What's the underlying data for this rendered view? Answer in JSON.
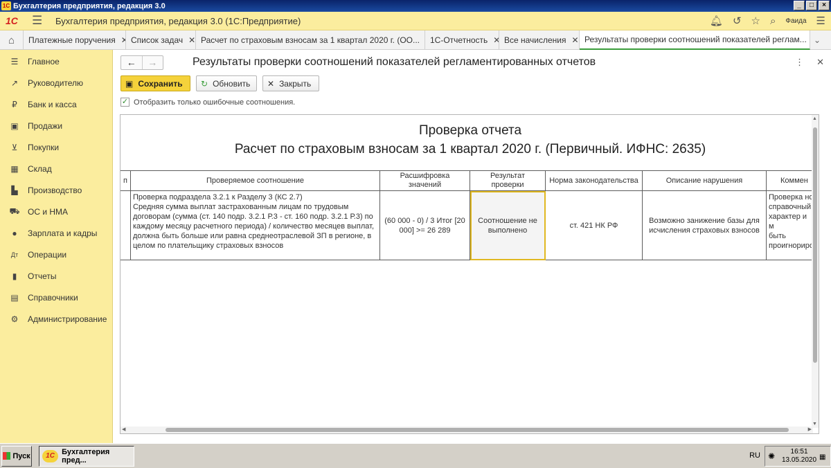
{
  "window": {
    "title": "Бухгалтерия предприятия, редакция 3.0",
    "logo_text": "1С",
    "min": "_",
    "max": "□",
    "close": "×"
  },
  "header": {
    "logo_text": "1С",
    "title": "Бухгалтерия предприятия, редакция 3.0  (1С:Предприятие)",
    "user": "Фаида"
  },
  "tabs": [
    {
      "label": "Платежные поручения"
    },
    {
      "label": "Список задач"
    },
    {
      "label": "Расчет по страховым взносам за 1 квартал 2020 г. (ОО..."
    },
    {
      "label": "1С-Отчетность"
    },
    {
      "label": "Все начисления"
    },
    {
      "label": "Результаты проверки соотношений показателей реглам..."
    }
  ],
  "sidebar": {
    "items": [
      {
        "label": "Главное",
        "icon": "menu-icon"
      },
      {
        "label": "Руководителю",
        "icon": "trend-icon"
      },
      {
        "label": "Банк и касса",
        "icon": "ruble-icon"
      },
      {
        "label": "Продажи",
        "icon": "bag-icon"
      },
      {
        "label": "Покупки",
        "icon": "cart-icon"
      },
      {
        "label": "Склад",
        "icon": "grid-icon"
      },
      {
        "label": "Производство",
        "icon": "factory-icon"
      },
      {
        "label": "ОС и НМА",
        "icon": "truck-icon"
      },
      {
        "label": "Зарплата и кадры",
        "icon": "person-icon"
      },
      {
        "label": "Операции",
        "icon": "dt-kt-icon"
      },
      {
        "label": "Отчеты",
        "icon": "bar-chart-icon"
      },
      {
        "label": "Справочники",
        "icon": "book-icon"
      },
      {
        "label": "Администрирование",
        "icon": "gear-icon"
      }
    ]
  },
  "form": {
    "title": "Результаты проверки соотношений показателей регламентированных отчетов",
    "save_label": "Сохранить",
    "refresh_label": "Обновить",
    "close_label": "Закрыть",
    "checkbox_label": "Отобразить только ошибочные соотношения.",
    "checkbox_checked": true
  },
  "report": {
    "title1": "Проверка отчета",
    "title2": "Расчет по страховым взносам за 1 квартал 2020 г. (Первичный. ИФНС: 2635)",
    "columns": [
      "п",
      "Проверяемое соотношение",
      "Расшифровка значений",
      "Результат проверки",
      "Норма законодательства",
      "Описание нарушения",
      "Коммен"
    ],
    "row": {
      "relation": "Проверка подраздела 3.2.1 к Разделу 3 (КС 2.7)\nСредняя сумма выплат застрахованным лицам по трудовым договорам (сумма (ст. 140 подр. 3.2.1 Р.3 - ст. 160 подр. 3.2.1 Р.3) по каждому месяцу расчетного периода) / количество месяцев выплат, должна быть больше или равна среднеотраслевой ЗП в регионе, в целом по плательщику страховых взносов",
      "decoding": "(60 000 - 0) / 3 Итог [20 000] >= 26 289",
      "result": "Соотношение не выполнено",
      "norm": "ст. 421 НК РФ",
      "violation": "Возможно занижение базы для исчисления страховых взносов",
      "comment": "Проверка но\nсправочный\nхарактер и м\nбыть\nпроигнориро"
    }
  },
  "taskbar": {
    "start_label": "Пуск",
    "task_label": "Бухгалтерия пред...",
    "lang": "RU",
    "time": "16:51",
    "date": "13.05.2020"
  },
  "colors": {
    "accent_yellow": "#fbed9e",
    "button_primary": "#f5d23b",
    "error_text": "#d62020",
    "active_tab": "#3a9d3a"
  }
}
